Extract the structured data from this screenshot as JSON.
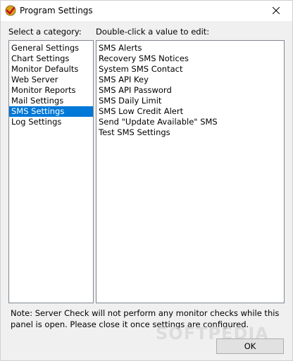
{
  "window": {
    "title": "Program Settings",
    "app_icon": "server-check-icon",
    "close_icon": "close-icon"
  },
  "labels": {
    "category": "Select a category:",
    "values": "Double-click a value to edit:"
  },
  "categories": [
    {
      "label": "General Settings",
      "selected": false
    },
    {
      "label": "Chart Settings",
      "selected": false
    },
    {
      "label": "Monitor Defaults",
      "selected": false
    },
    {
      "label": "Web Server",
      "selected": false
    },
    {
      "label": "Monitor Reports",
      "selected": false
    },
    {
      "label": "Mail Settings",
      "selected": false
    },
    {
      "label": "SMS Settings",
      "selected": true
    },
    {
      "label": "Log Settings",
      "selected": false
    }
  ],
  "values": [
    "SMS Alerts",
    "Recovery SMS Notices",
    "System SMS Contact",
    "SMS API Key",
    "SMS API Password",
    "SMS Daily Limit",
    "SMS Low Credit Alert",
    "Send \"Update Available\" SMS",
    "Test SMS Settings"
  ],
  "note": "Note: Server Check will not perform any monitor checks while this panel is open. Please close it once settings are configured.",
  "buttons": {
    "ok": "OK"
  },
  "watermark": "SOFTPEDIA",
  "colors": {
    "selection": "#0078d7",
    "dialog_bg": "#f0f0f0",
    "list_border": "#828790"
  }
}
